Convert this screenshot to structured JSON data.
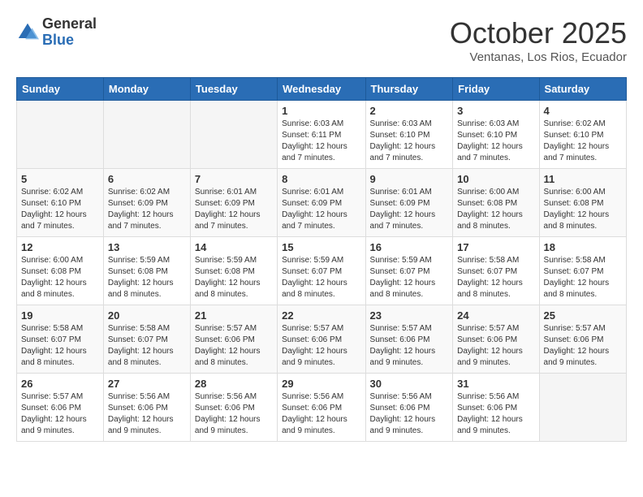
{
  "header": {
    "logo_general": "General",
    "logo_blue": "Blue",
    "month_title": "October 2025",
    "subtitle": "Ventanas, Los Rios, Ecuador"
  },
  "weekdays": [
    "Sunday",
    "Monday",
    "Tuesday",
    "Wednesday",
    "Thursday",
    "Friday",
    "Saturday"
  ],
  "weeks": [
    [
      {
        "day": "",
        "info": ""
      },
      {
        "day": "",
        "info": ""
      },
      {
        "day": "",
        "info": ""
      },
      {
        "day": "1",
        "info": "Sunrise: 6:03 AM\nSunset: 6:11 PM\nDaylight: 12 hours\nand 7 minutes."
      },
      {
        "day": "2",
        "info": "Sunrise: 6:03 AM\nSunset: 6:10 PM\nDaylight: 12 hours\nand 7 minutes."
      },
      {
        "day": "3",
        "info": "Sunrise: 6:03 AM\nSunset: 6:10 PM\nDaylight: 12 hours\nand 7 minutes."
      },
      {
        "day": "4",
        "info": "Sunrise: 6:02 AM\nSunset: 6:10 PM\nDaylight: 12 hours\nand 7 minutes."
      }
    ],
    [
      {
        "day": "5",
        "info": "Sunrise: 6:02 AM\nSunset: 6:10 PM\nDaylight: 12 hours\nand 7 minutes."
      },
      {
        "day": "6",
        "info": "Sunrise: 6:02 AM\nSunset: 6:09 PM\nDaylight: 12 hours\nand 7 minutes."
      },
      {
        "day": "7",
        "info": "Sunrise: 6:01 AM\nSunset: 6:09 PM\nDaylight: 12 hours\nand 7 minutes."
      },
      {
        "day": "8",
        "info": "Sunrise: 6:01 AM\nSunset: 6:09 PM\nDaylight: 12 hours\nand 7 minutes."
      },
      {
        "day": "9",
        "info": "Sunrise: 6:01 AM\nSunset: 6:09 PM\nDaylight: 12 hours\nand 7 minutes."
      },
      {
        "day": "10",
        "info": "Sunrise: 6:00 AM\nSunset: 6:08 PM\nDaylight: 12 hours\nand 8 minutes."
      },
      {
        "day": "11",
        "info": "Sunrise: 6:00 AM\nSunset: 6:08 PM\nDaylight: 12 hours\nand 8 minutes."
      }
    ],
    [
      {
        "day": "12",
        "info": "Sunrise: 6:00 AM\nSunset: 6:08 PM\nDaylight: 12 hours\nand 8 minutes."
      },
      {
        "day": "13",
        "info": "Sunrise: 5:59 AM\nSunset: 6:08 PM\nDaylight: 12 hours\nand 8 minutes."
      },
      {
        "day": "14",
        "info": "Sunrise: 5:59 AM\nSunset: 6:08 PM\nDaylight: 12 hours\nand 8 minutes."
      },
      {
        "day": "15",
        "info": "Sunrise: 5:59 AM\nSunset: 6:07 PM\nDaylight: 12 hours\nand 8 minutes."
      },
      {
        "day": "16",
        "info": "Sunrise: 5:59 AM\nSunset: 6:07 PM\nDaylight: 12 hours\nand 8 minutes."
      },
      {
        "day": "17",
        "info": "Sunrise: 5:58 AM\nSunset: 6:07 PM\nDaylight: 12 hours\nand 8 minutes."
      },
      {
        "day": "18",
        "info": "Sunrise: 5:58 AM\nSunset: 6:07 PM\nDaylight: 12 hours\nand 8 minutes."
      }
    ],
    [
      {
        "day": "19",
        "info": "Sunrise: 5:58 AM\nSunset: 6:07 PM\nDaylight: 12 hours\nand 8 minutes."
      },
      {
        "day": "20",
        "info": "Sunrise: 5:58 AM\nSunset: 6:07 PM\nDaylight: 12 hours\nand 8 minutes."
      },
      {
        "day": "21",
        "info": "Sunrise: 5:57 AM\nSunset: 6:06 PM\nDaylight: 12 hours\nand 8 minutes."
      },
      {
        "day": "22",
        "info": "Sunrise: 5:57 AM\nSunset: 6:06 PM\nDaylight: 12 hours\nand 9 minutes."
      },
      {
        "day": "23",
        "info": "Sunrise: 5:57 AM\nSunset: 6:06 PM\nDaylight: 12 hours\nand 9 minutes."
      },
      {
        "day": "24",
        "info": "Sunrise: 5:57 AM\nSunset: 6:06 PM\nDaylight: 12 hours\nand 9 minutes."
      },
      {
        "day": "25",
        "info": "Sunrise: 5:57 AM\nSunset: 6:06 PM\nDaylight: 12 hours\nand 9 minutes."
      }
    ],
    [
      {
        "day": "26",
        "info": "Sunrise: 5:57 AM\nSunset: 6:06 PM\nDaylight: 12 hours\nand 9 minutes."
      },
      {
        "day": "27",
        "info": "Sunrise: 5:56 AM\nSunset: 6:06 PM\nDaylight: 12 hours\nand 9 minutes."
      },
      {
        "day": "28",
        "info": "Sunrise: 5:56 AM\nSunset: 6:06 PM\nDaylight: 12 hours\nand 9 minutes."
      },
      {
        "day": "29",
        "info": "Sunrise: 5:56 AM\nSunset: 6:06 PM\nDaylight: 12 hours\nand 9 minutes."
      },
      {
        "day": "30",
        "info": "Sunrise: 5:56 AM\nSunset: 6:06 PM\nDaylight: 12 hours\nand 9 minutes."
      },
      {
        "day": "31",
        "info": "Sunrise: 5:56 AM\nSunset: 6:06 PM\nDaylight: 12 hours\nand 9 minutes."
      },
      {
        "day": "",
        "info": ""
      }
    ]
  ]
}
